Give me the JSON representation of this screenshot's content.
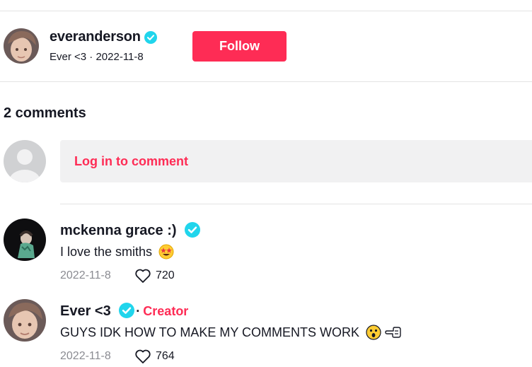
{
  "post_author": {
    "username": "everanderson",
    "nickname": "Ever <3",
    "date": "2022-11-8",
    "separator": " · ",
    "follow_label": "Follow",
    "verified": true
  },
  "comments_header": "2 comments",
  "login_prompt": "Log in to comment",
  "comments": [
    {
      "name": "mckenna grace :)",
      "text": "I love the smiths",
      "emoji": [
        "star-struck-emoji"
      ],
      "date": "2022-11-8",
      "likes": "720",
      "verified": true
    },
    {
      "name": "Ever <3",
      "badge": "Creator",
      "badge_separator": "·",
      "text": "GUYS IDK HOW TO MAKE MY COMMENTS WORK",
      "emoji": [
        "astonished-face-emoji",
        "pointing-left-emoji"
      ],
      "date": "2022-11-8",
      "likes": "764",
      "verified": true
    }
  ],
  "colors": {
    "accent": "#fe2c55",
    "verified": "#20d5ec",
    "muted": "#8a8b91",
    "input_bg": "#f1f1f2"
  }
}
